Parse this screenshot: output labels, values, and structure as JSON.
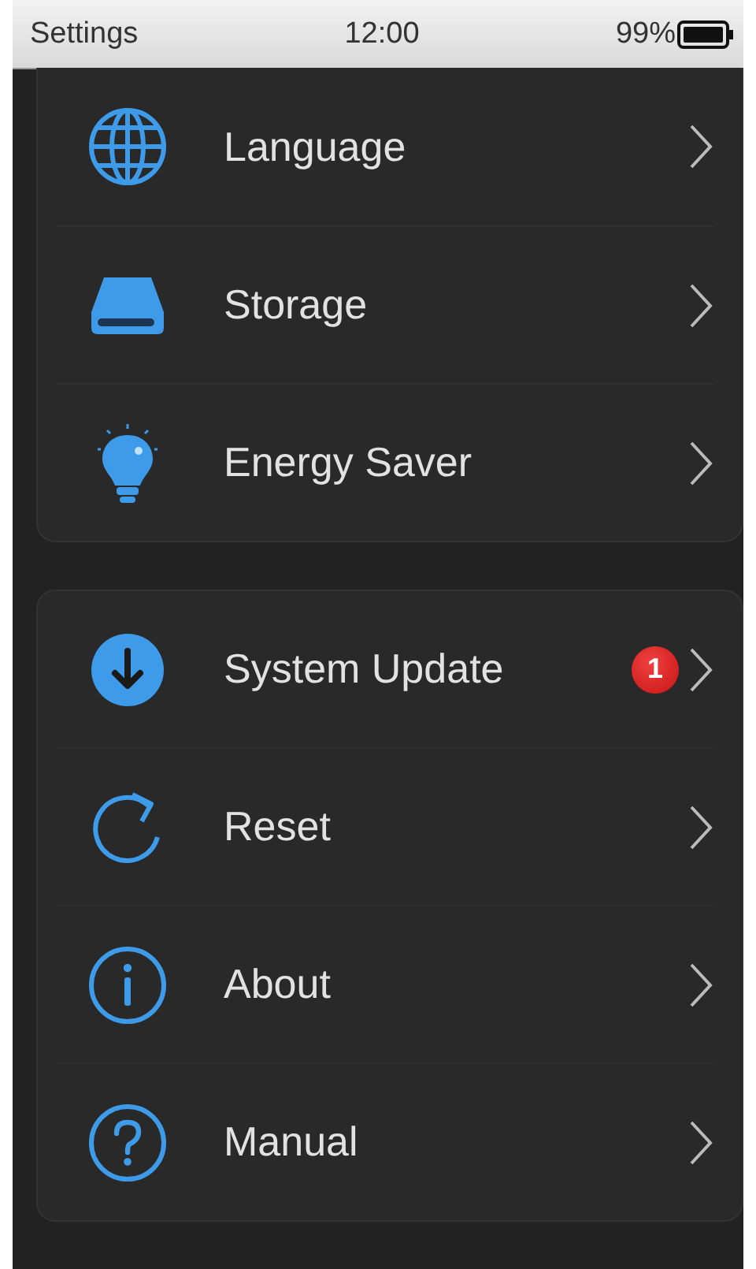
{
  "status_bar": {
    "title": "Settings",
    "time": "12:00",
    "battery": "99%"
  },
  "groups": [
    {
      "items": [
        {
          "label": "Language"
        },
        {
          "label": "Storage"
        },
        {
          "label": "Energy Saver"
        }
      ]
    },
    {
      "items": [
        {
          "label": "System Update",
          "badge": "1"
        },
        {
          "label": "Reset"
        },
        {
          "label": "About"
        },
        {
          "label": "Manual"
        }
      ]
    }
  ]
}
